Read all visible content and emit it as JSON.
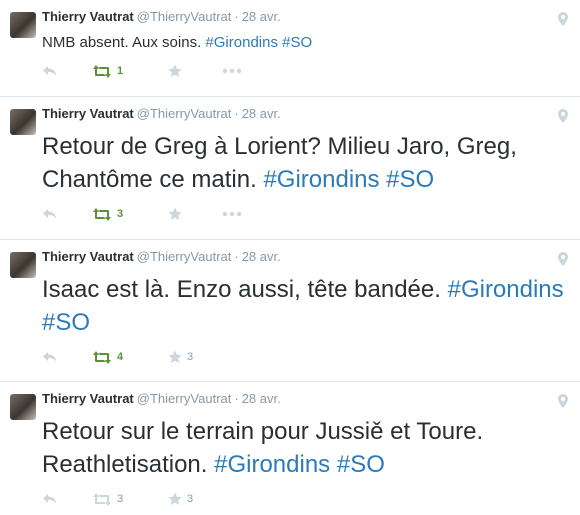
{
  "tweets": [
    {
      "author": "Thierry Vautrat",
      "handle": "@ThierryVautrat",
      "sep": "·",
      "time": "28 avr.",
      "text": "NMB absent. Aux soins. ",
      "hashtags": [
        "#Girondins",
        "#SO"
      ],
      "retweets": "1",
      "favorites": ""
    },
    {
      "author": "Thierry Vautrat",
      "handle": "@ThierryVautrat",
      "sep": "·",
      "time": "28 avr.",
      "text": "Retour de Greg à Lorient? Milieu Jaro, Greg, Chantôme ce matin. ",
      "hashtags": [
        "#Girondins",
        "#SO"
      ],
      "retweets": "3",
      "favorites": ""
    },
    {
      "author": "Thierry Vautrat",
      "handle": "@ThierryVautrat",
      "sep": "·",
      "time": "28 avr.",
      "text": "Isaac est là.  Enzo aussi, tête bandée. ",
      "hashtags": [
        "#Girondins",
        "#SO"
      ],
      "retweets": "4",
      "favorites": "3"
    },
    {
      "author": "Thierry Vautrat",
      "handle": "@ThierryVautrat",
      "sep": "·",
      "time": "28 avr.",
      "text": "Retour sur le terrain pour Jussiě et Toure. Reathletisation.  ",
      "hashtags": [
        "#Girondins",
        "#SO"
      ],
      "retweets": "3",
      "favorites": "3"
    }
  ],
  "colors": {
    "hashtag": "#2b7bb9",
    "retweet_active": "#5c913b",
    "muted": "#8899a6"
  }
}
